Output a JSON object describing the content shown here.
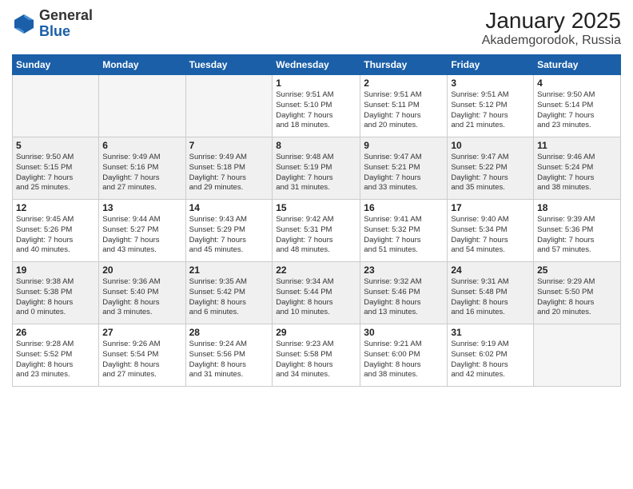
{
  "header": {
    "logo_general": "General",
    "logo_blue": "Blue",
    "title": "January 2025",
    "subtitle": "Akademgorodok, Russia"
  },
  "weekdays": [
    "Sunday",
    "Monday",
    "Tuesday",
    "Wednesday",
    "Thursday",
    "Friday",
    "Saturday"
  ],
  "weeks": [
    [
      {
        "day": "",
        "info": ""
      },
      {
        "day": "",
        "info": ""
      },
      {
        "day": "",
        "info": ""
      },
      {
        "day": "1",
        "info": "Sunrise: 9:51 AM\nSunset: 5:10 PM\nDaylight: 7 hours\nand 18 minutes."
      },
      {
        "day": "2",
        "info": "Sunrise: 9:51 AM\nSunset: 5:11 PM\nDaylight: 7 hours\nand 20 minutes."
      },
      {
        "day": "3",
        "info": "Sunrise: 9:51 AM\nSunset: 5:12 PM\nDaylight: 7 hours\nand 21 minutes."
      },
      {
        "day": "4",
        "info": "Sunrise: 9:50 AM\nSunset: 5:14 PM\nDaylight: 7 hours\nand 23 minutes."
      }
    ],
    [
      {
        "day": "5",
        "info": "Sunrise: 9:50 AM\nSunset: 5:15 PM\nDaylight: 7 hours\nand 25 minutes."
      },
      {
        "day": "6",
        "info": "Sunrise: 9:49 AM\nSunset: 5:16 PM\nDaylight: 7 hours\nand 27 minutes."
      },
      {
        "day": "7",
        "info": "Sunrise: 9:49 AM\nSunset: 5:18 PM\nDaylight: 7 hours\nand 29 minutes."
      },
      {
        "day": "8",
        "info": "Sunrise: 9:48 AM\nSunset: 5:19 PM\nDaylight: 7 hours\nand 31 minutes."
      },
      {
        "day": "9",
        "info": "Sunrise: 9:47 AM\nSunset: 5:21 PM\nDaylight: 7 hours\nand 33 minutes."
      },
      {
        "day": "10",
        "info": "Sunrise: 9:47 AM\nSunset: 5:22 PM\nDaylight: 7 hours\nand 35 minutes."
      },
      {
        "day": "11",
        "info": "Sunrise: 9:46 AM\nSunset: 5:24 PM\nDaylight: 7 hours\nand 38 minutes."
      }
    ],
    [
      {
        "day": "12",
        "info": "Sunrise: 9:45 AM\nSunset: 5:26 PM\nDaylight: 7 hours\nand 40 minutes."
      },
      {
        "day": "13",
        "info": "Sunrise: 9:44 AM\nSunset: 5:27 PM\nDaylight: 7 hours\nand 43 minutes."
      },
      {
        "day": "14",
        "info": "Sunrise: 9:43 AM\nSunset: 5:29 PM\nDaylight: 7 hours\nand 45 minutes."
      },
      {
        "day": "15",
        "info": "Sunrise: 9:42 AM\nSunset: 5:31 PM\nDaylight: 7 hours\nand 48 minutes."
      },
      {
        "day": "16",
        "info": "Sunrise: 9:41 AM\nSunset: 5:32 PM\nDaylight: 7 hours\nand 51 minutes."
      },
      {
        "day": "17",
        "info": "Sunrise: 9:40 AM\nSunset: 5:34 PM\nDaylight: 7 hours\nand 54 minutes."
      },
      {
        "day": "18",
        "info": "Sunrise: 9:39 AM\nSunset: 5:36 PM\nDaylight: 7 hours\nand 57 minutes."
      }
    ],
    [
      {
        "day": "19",
        "info": "Sunrise: 9:38 AM\nSunset: 5:38 PM\nDaylight: 8 hours\nand 0 minutes."
      },
      {
        "day": "20",
        "info": "Sunrise: 9:36 AM\nSunset: 5:40 PM\nDaylight: 8 hours\nand 3 minutes."
      },
      {
        "day": "21",
        "info": "Sunrise: 9:35 AM\nSunset: 5:42 PM\nDaylight: 8 hours\nand 6 minutes."
      },
      {
        "day": "22",
        "info": "Sunrise: 9:34 AM\nSunset: 5:44 PM\nDaylight: 8 hours\nand 10 minutes."
      },
      {
        "day": "23",
        "info": "Sunrise: 9:32 AM\nSunset: 5:46 PM\nDaylight: 8 hours\nand 13 minutes."
      },
      {
        "day": "24",
        "info": "Sunrise: 9:31 AM\nSunset: 5:48 PM\nDaylight: 8 hours\nand 16 minutes."
      },
      {
        "day": "25",
        "info": "Sunrise: 9:29 AM\nSunset: 5:50 PM\nDaylight: 8 hours\nand 20 minutes."
      }
    ],
    [
      {
        "day": "26",
        "info": "Sunrise: 9:28 AM\nSunset: 5:52 PM\nDaylight: 8 hours\nand 23 minutes."
      },
      {
        "day": "27",
        "info": "Sunrise: 9:26 AM\nSunset: 5:54 PM\nDaylight: 8 hours\nand 27 minutes."
      },
      {
        "day": "28",
        "info": "Sunrise: 9:24 AM\nSunset: 5:56 PM\nDaylight: 8 hours\nand 31 minutes."
      },
      {
        "day": "29",
        "info": "Sunrise: 9:23 AM\nSunset: 5:58 PM\nDaylight: 8 hours\nand 34 minutes."
      },
      {
        "day": "30",
        "info": "Sunrise: 9:21 AM\nSunset: 6:00 PM\nDaylight: 8 hours\nand 38 minutes."
      },
      {
        "day": "31",
        "info": "Sunrise: 9:19 AM\nSunset: 6:02 PM\nDaylight: 8 hours\nand 42 minutes."
      },
      {
        "day": "",
        "info": ""
      }
    ]
  ]
}
